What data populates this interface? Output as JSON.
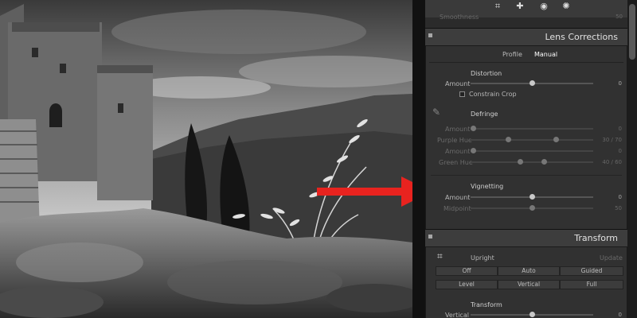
{
  "toolbar": {
    "icons": [
      "crop-icon",
      "healing-icon",
      "redeye-icon",
      "mask-icon"
    ],
    "smoothness_label": "Smoothness",
    "smoothness_value": "50"
  },
  "lens_corrections": {
    "title": "Lens Corrections",
    "tabs": [
      {
        "label": "Profile",
        "active": false
      },
      {
        "label": "Manual",
        "active": true
      }
    ],
    "distortion": {
      "heading": "Distortion",
      "amount_label": "Amount",
      "amount_value": "0",
      "constrain_crop": "Constrain Crop"
    },
    "defringe": {
      "heading": "Defringe",
      "rows": [
        {
          "label": "Amount",
          "value": "0"
        },
        {
          "label": "Purple Hue",
          "value": "30 / 70"
        },
        {
          "label": "Amount",
          "value": "0"
        },
        {
          "label": "Green Hue",
          "value": "40 / 60"
        }
      ]
    },
    "vignetting": {
      "heading": "Vignetting",
      "amount_label": "Amount",
      "amount_value": "0",
      "midpoint_label": "Midpoint",
      "midpoint_value": "50"
    }
  },
  "transform": {
    "title": "Transform",
    "upright_label": "Upright",
    "update_label": "Update",
    "buttons_row1": [
      "Off",
      "Auto",
      "Guided"
    ],
    "buttons_row2": [
      "Level",
      "Vertical",
      "Full"
    ],
    "sub_heading": "Transform",
    "vertical_label": "Vertical",
    "vertical_value": "0"
  },
  "colors": {
    "arrow": "#e8231f",
    "panel_bg": "#2b2b2b"
  }
}
